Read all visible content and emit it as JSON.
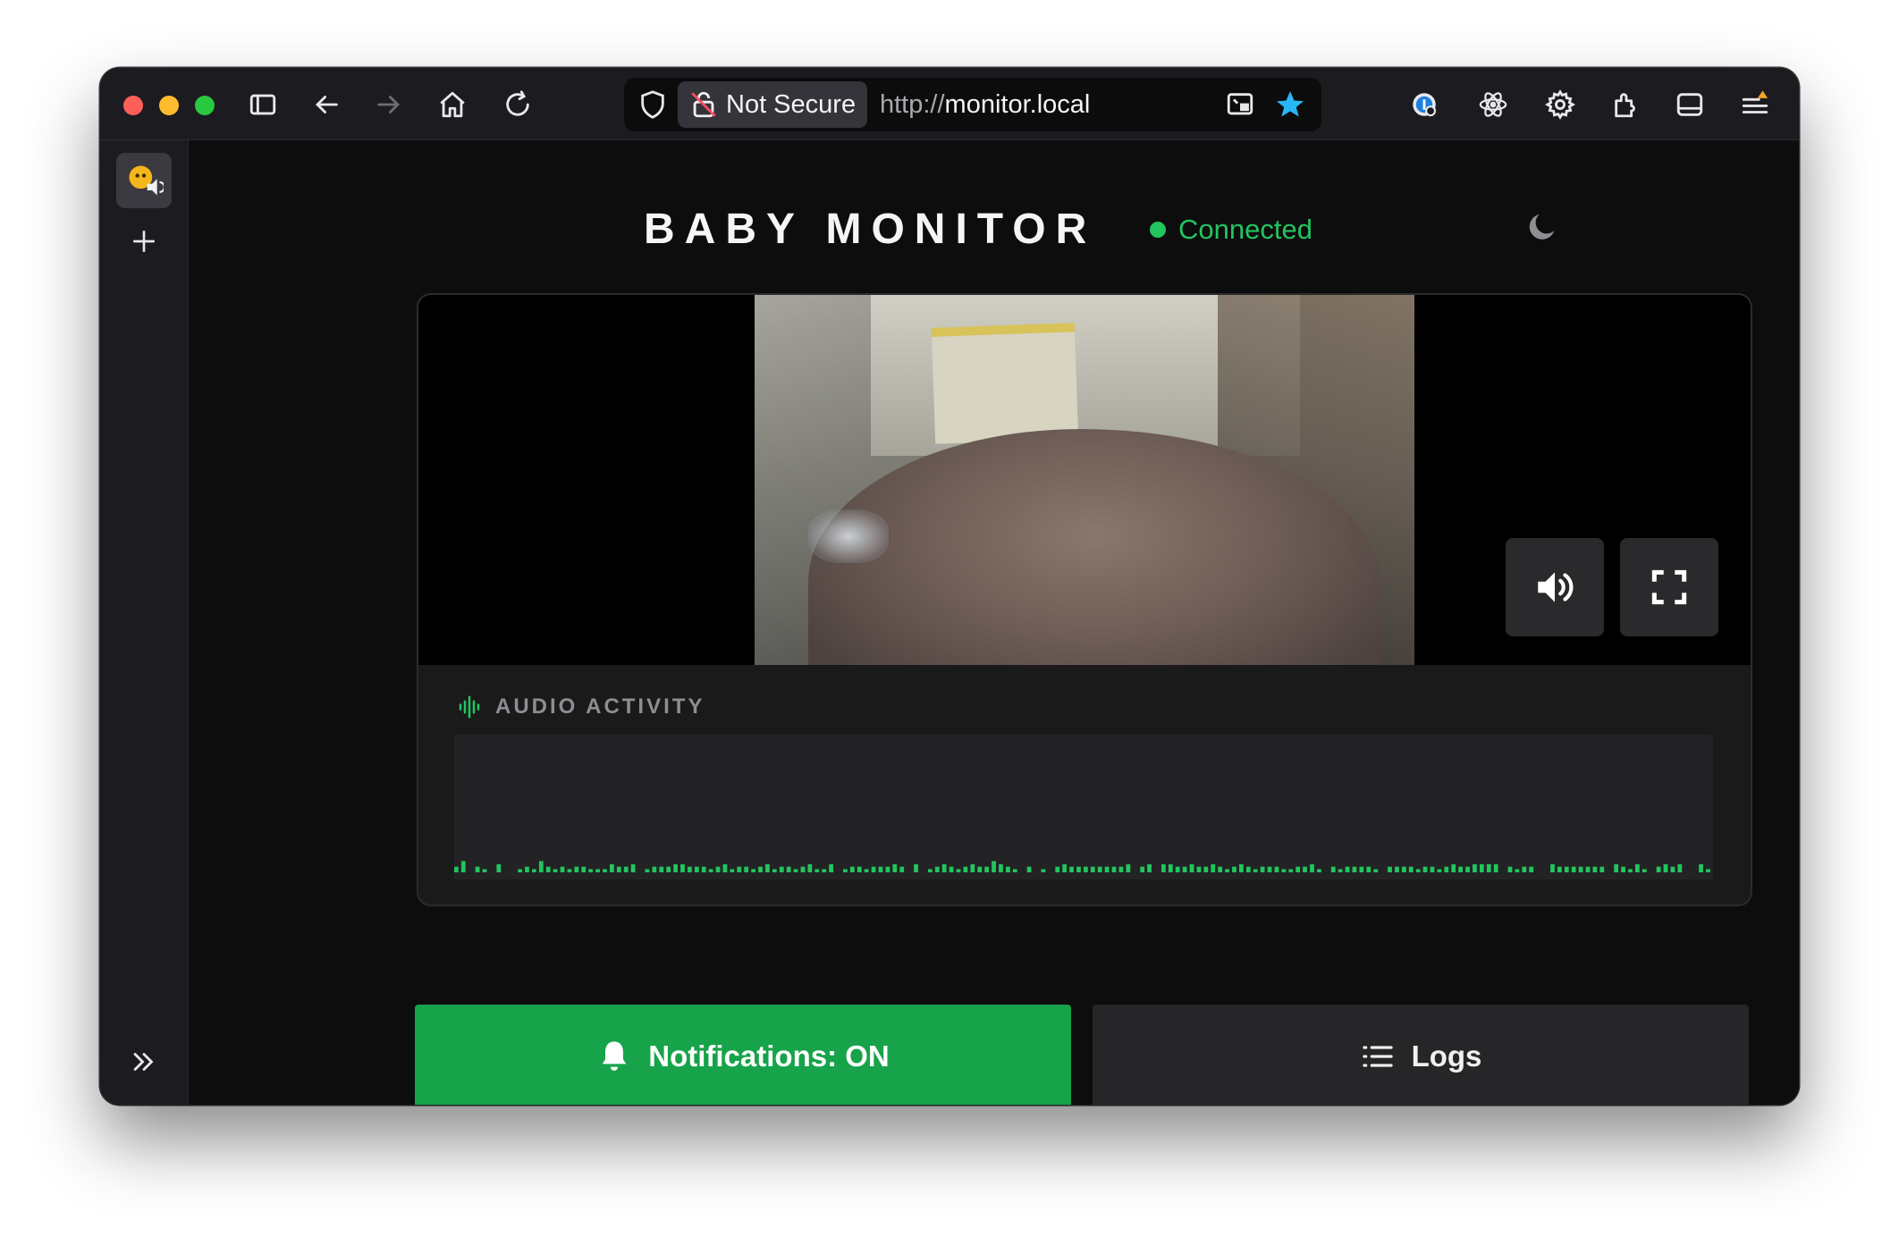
{
  "browser": {
    "security_label": "Not Secure",
    "url_protocol": "http://",
    "url_host": "monitor.local"
  },
  "app": {
    "title": "BABY MONITOR",
    "status": "Connected",
    "audio_heading": "AUDIO ACTIVITY",
    "notifications_label": "Notifications: ON",
    "logs_label": "Logs",
    "audio_levels": [
      0.35,
      0.7,
      0,
      0.35,
      0.2,
      0,
      0.5,
      0,
      0,
      0.2,
      0.35,
      0.2,
      0.7,
      0.35,
      0.2,
      0.35,
      0.2,
      0.35,
      0.35,
      0.2,
      0.2,
      0.2,
      0.5,
      0.35,
      0.35,
      0.5,
      0,
      0.2,
      0.35,
      0.35,
      0.35,
      0.5,
      0.5,
      0.35,
      0.35,
      0.35,
      0.2,
      0.35,
      0.5,
      0.2,
      0.35,
      0.35,
      0.2,
      0.35,
      0.5,
      0.2,
      0.35,
      0.35,
      0.2,
      0.35,
      0.5,
      0.2,
      0.2,
      0.5,
      0,
      0.2,
      0.35,
      0.35,
      0.2,
      0.35,
      0.35,
      0.35,
      0.5,
      0.35,
      0,
      0.5,
      0,
      0.2,
      0.35,
      0.5,
      0.35,
      0.2,
      0.35,
      0.5,
      0.35,
      0.35,
      0.7,
      0.5,
      0.35,
      0.2,
      0,
      0.35,
      0,
      0.2,
      0,
      0.35,
      0.5,
      0.35,
      0.35,
      0.35,
      0.35,
      0.35,
      0.35,
      0.35,
      0.35,
      0.5,
      0,
      0.35,
      0.5,
      0,
      0.5,
      0.5,
      0.35,
      0.35,
      0.5,
      0.35,
      0.35,
      0.5,
      0.35,
      0.2,
      0.35,
      0.5,
      0.35,
      0.2,
      0.35,
      0.35,
      0.35,
      0.2,
      0.2,
      0.35,
      0.35,
      0.5,
      0.2,
      0,
      0.35,
      0.2,
      0.35,
      0.35,
      0.35,
      0.35,
      0.2,
      0,
      0.35,
      0.35,
      0.35,
      0.35,
      0.2,
      0.35,
      0.35,
      0.2,
      0.35,
      0.5,
      0.35,
      0.35,
      0.5,
      0.5,
      0.5,
      0.5,
      0,
      0.35,
      0.2,
      0.35,
      0.35,
      0,
      0,
      0.5,
      0.35,
      0.35,
      0.35,
      0.35,
      0.35,
      0.35,
      0.35,
      0,
      0.5,
      0.35,
      0.2,
      0.5,
      0.2,
      0,
      0.35,
      0.5,
      0.35,
      0.5,
      0,
      0,
      0.5,
      0.2
    ],
    "audio_bar_color": "#22c55e",
    "accent_color": "#16a34a"
  },
  "icons": {
    "shield": "shield-icon",
    "lock": "insecure-lock-icon",
    "theme": "moon-icon",
    "audio": "speaker-icon",
    "fullscreen": "fullscreen-icon",
    "notify": "bell-icon",
    "logs": "list-icon"
  }
}
